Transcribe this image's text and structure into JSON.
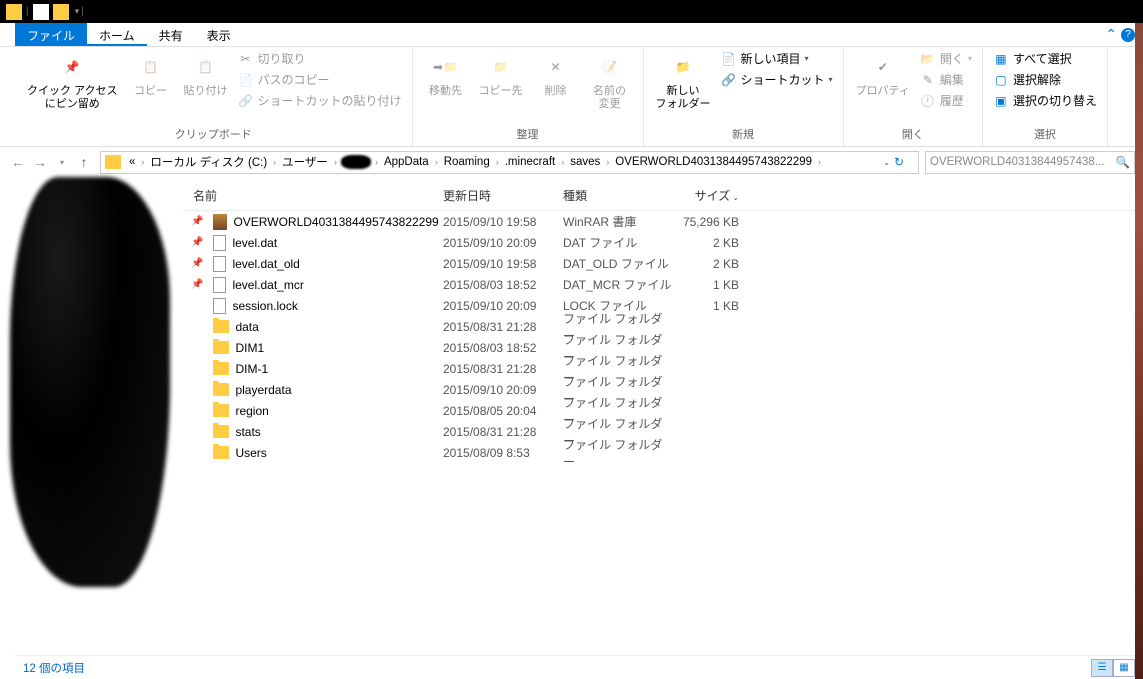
{
  "tabs": {
    "file": "ファイル",
    "home": "ホーム",
    "share": "共有",
    "view": "表示"
  },
  "ribbon": {
    "clipboard": {
      "pin": "クイック アクセス\nにピン留め",
      "copy": "コピー",
      "paste": "貼り付け",
      "cut": "切り取り",
      "copypath": "パスのコピー",
      "pasteshortcut": "ショートカットの貼り付け",
      "label": "クリップボード"
    },
    "organize": {
      "moveto": "移動先",
      "copyto": "コピー先",
      "delete": "削除",
      "rename": "名前の\n変更",
      "label": "整理"
    },
    "new": {
      "newfolder": "新しい\nフォルダー",
      "newitem": "新しい項目",
      "shortcut": "ショートカット",
      "label": "新規"
    },
    "open": {
      "properties": "プロパティ",
      "open": "開く",
      "edit": "編集",
      "history": "履歴",
      "label": "開く"
    },
    "select": {
      "all": "すべて選択",
      "none": "選択解除",
      "invert": "選択の切り替え",
      "label": "選択"
    }
  },
  "breadcrumbs": [
    "«",
    "ローカル ディスク (C:)",
    "ユーザー",
    "",
    "AppData",
    "Roaming",
    ".minecraft",
    "saves",
    "OVERWORLD4031384495743822299"
  ],
  "search_placeholder": "OVERWORLD40313844957438...",
  "columns": {
    "name": "名前",
    "date": "更新日時",
    "type": "種類",
    "size": "サイズ"
  },
  "files": [
    {
      "icon": "rar",
      "name": "OVERWORLD4031384495743822299",
      "date": "2015/09/10 19:58",
      "type": "WinRAR 書庫",
      "size": "75,296 KB",
      "pinned": true
    },
    {
      "icon": "file",
      "name": "level.dat",
      "date": "2015/09/10 20:09",
      "type": "DAT ファイル",
      "size": "2 KB",
      "pinned": true
    },
    {
      "icon": "file",
      "name": "level.dat_old",
      "date": "2015/09/10 19:58",
      "type": "DAT_OLD ファイル",
      "size": "2 KB",
      "pinned": true
    },
    {
      "icon": "file",
      "name": "level.dat_mcr",
      "date": "2015/08/03 18:52",
      "type": "DAT_MCR ファイル",
      "size": "1 KB",
      "pinned": true
    },
    {
      "icon": "file",
      "name": "session.lock",
      "date": "2015/09/10 20:09",
      "type": "LOCK ファイル",
      "size": "1 KB",
      "pinned": false
    },
    {
      "icon": "folder",
      "name": "data",
      "date": "2015/08/31 21:28",
      "type": "ファイル フォルダー",
      "size": "",
      "pinned": false
    },
    {
      "icon": "folder",
      "name": "DIM1",
      "date": "2015/08/03 18:52",
      "type": "ファイル フォルダー",
      "size": "",
      "pinned": false
    },
    {
      "icon": "folder",
      "name": "DIM-1",
      "date": "2015/08/31 21:28",
      "type": "ファイル フォルダー",
      "size": "",
      "pinned": false
    },
    {
      "icon": "folder",
      "name": "playerdata",
      "date": "2015/09/10 20:09",
      "type": "ファイル フォルダー",
      "size": "",
      "pinned": false
    },
    {
      "icon": "folder",
      "name": "region",
      "date": "2015/08/05 20:04",
      "type": "ファイル フォルダー",
      "size": "",
      "pinned": false
    },
    {
      "icon": "folder",
      "name": "stats",
      "date": "2015/08/31 21:28",
      "type": "ファイル フォルダー",
      "size": "",
      "pinned": false
    },
    {
      "icon": "folder",
      "name": "Users",
      "date": "2015/08/09 8:53",
      "type": "ファイル フォルダー",
      "size": "",
      "pinned": false
    }
  ],
  "status": "12 個の項目"
}
